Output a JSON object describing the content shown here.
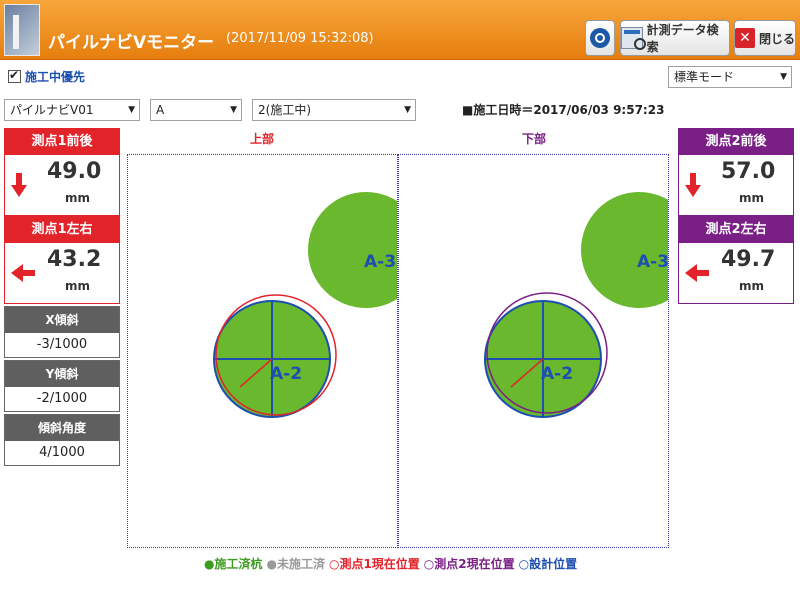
{
  "window": {
    "title": "パイルナビVモニター",
    "datetime": "(2017/11/09 15:32:08)"
  },
  "toolbar": {
    "search_label": "計測データ検索",
    "close_label": "閉じる"
  },
  "controls": {
    "priority_label": "施工中優先",
    "priority_checked": true,
    "mode_value": "標準モード",
    "navi_value": "パイルナビV01",
    "group_value": "A",
    "stage_value": "2(施工中)",
    "start_time": "■施工日時＝2017/06/03 9:57:23"
  },
  "measure1": {
    "front_back": {
      "label": "測点1前後",
      "value": "49.0",
      "unit": "mm"
    },
    "left_right": {
      "label": "測点1左右",
      "value": "43.2",
      "unit": "mm"
    }
  },
  "measure2": {
    "front_back": {
      "label": "測点2前後",
      "value": "57.0",
      "unit": "mm"
    },
    "left_right": {
      "label": "測点2左右",
      "value": "49.7",
      "unit": "mm"
    }
  },
  "tilt": {
    "x": {
      "label": "X傾斜",
      "value": "-3/1000"
    },
    "y": {
      "label": "Y傾斜",
      "value": "-2/1000"
    },
    "angle": {
      "label": "傾斜角度",
      "value": "4/1000"
    }
  },
  "panels": {
    "upper": {
      "label": "上部",
      "pile_label": "A-2",
      "neighbor_label": "A-3"
    },
    "lower": {
      "label": "下部",
      "pile_label": "A-2",
      "neighbor_label": "A-3"
    }
  },
  "legend": {
    "done": "●施工済杭",
    "not_done": "●未施工済",
    "point1": "○測点1現在位置",
    "point2": "○測点2現在位置",
    "design": "○設計位置"
  },
  "colors": {
    "accent": "#e67e0e",
    "red": "#e2232a",
    "purple": "#7a1f86",
    "blue": "#1d4fb0",
    "green": "#6ab82e"
  }
}
